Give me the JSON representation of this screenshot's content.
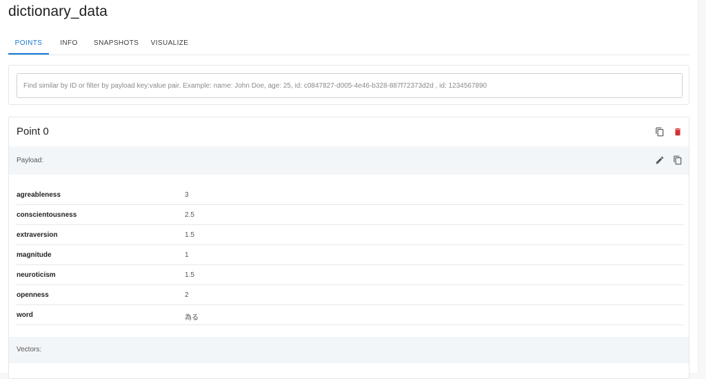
{
  "collection": {
    "title": "dictionary_data"
  },
  "tabs": [
    {
      "label": "POINTS",
      "active": true
    },
    {
      "label": "INFO",
      "active": false
    },
    {
      "label": "SNAPSHOTS",
      "active": false
    },
    {
      "label": "VISUALIZE",
      "active": false
    }
  ],
  "search": {
    "placeholder": "Find similar by ID or filter by payload key:value pair. Example: name: John Doe, age: 25, id: c0847827-d005-4e46-b328-887f72373d2d , id: 1234567890",
    "value": ""
  },
  "point": {
    "title": "Point 0",
    "payload_label": "Payload:",
    "vectors_label": "Vectors:",
    "payload": [
      {
        "key": "agreableness",
        "value": "3"
      },
      {
        "key": "conscientousness",
        "value": "2.5"
      },
      {
        "key": "extraversion",
        "value": "1.5"
      },
      {
        "key": "magnitude",
        "value": "1"
      },
      {
        "key": "neuroticism",
        "value": "1.5"
      },
      {
        "key": "openness",
        "value": "2"
      },
      {
        "key": "word",
        "value": "為る"
      }
    ]
  },
  "icons": {
    "copy": "copy-icon",
    "delete": "trash-icon",
    "edit": "pencil-icon"
  },
  "colors": {
    "accent": "#1976d2",
    "danger": "#d32f2f",
    "section_bg": "#f3f6f9"
  }
}
